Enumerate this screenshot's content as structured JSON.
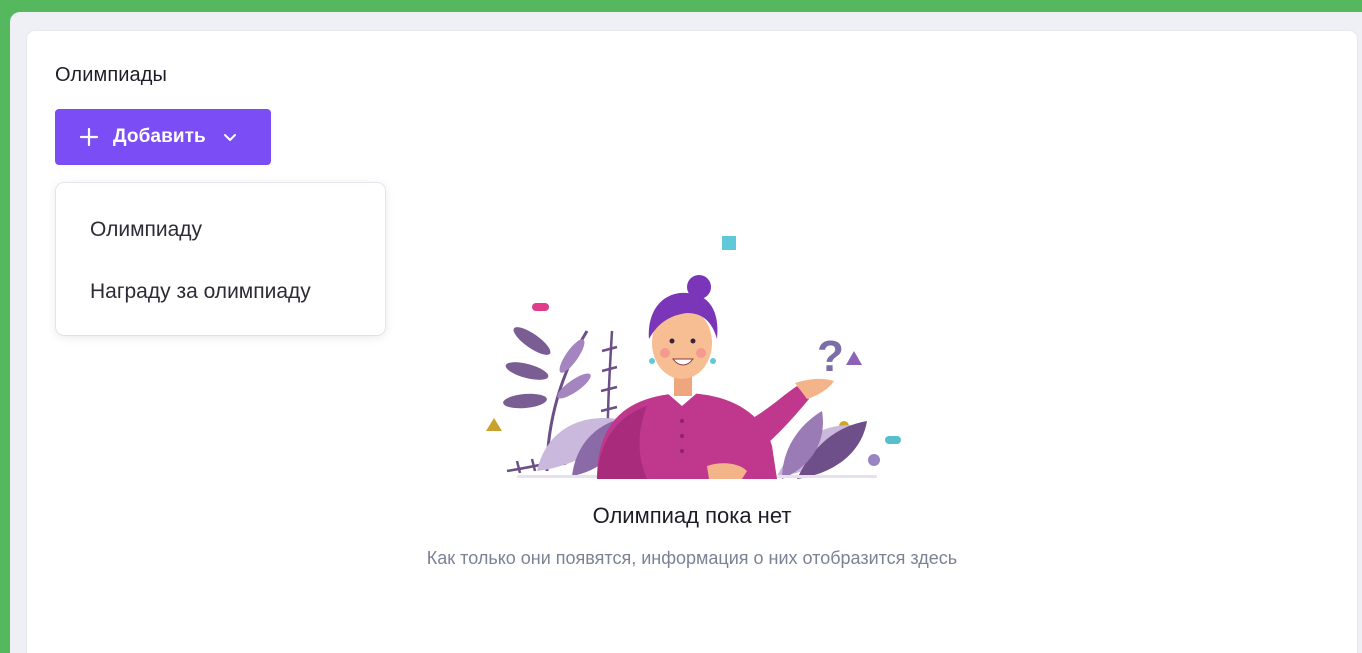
{
  "page": {
    "title": "Олимпиады"
  },
  "toolbar": {
    "add_label": "Добавить",
    "add_icon": "plus-icon",
    "dropdown_icon": "chevron-down-icon"
  },
  "dropdown": {
    "items": [
      {
        "label": "Олимпиаду"
      },
      {
        "label": "Награду за олимпиаду"
      }
    ]
  },
  "empty_state": {
    "title": "Олимпиад пока нет",
    "subtitle": "Как только они появятся, информация о них отобразится здесь",
    "illustration": "woman-with-question-mark-illustration"
  },
  "colors": {
    "outer_background": "#55b75e",
    "frame_background": "#eff0f5",
    "card_background": "#ffffff",
    "accent": "#7b4ef5",
    "title_text": "#1d1d27",
    "subtitle_text": "#7c8296"
  }
}
